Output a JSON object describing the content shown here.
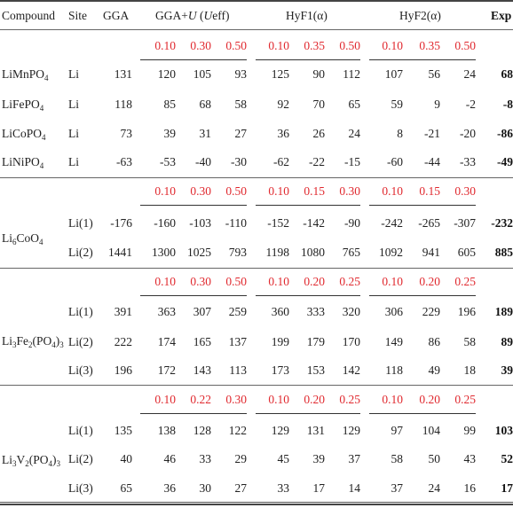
{
  "header": {
    "compound": "Compound",
    "site": "Site",
    "gga": "GGA",
    "ggau_prefix": "GGA+",
    "ggau_u": "U",
    "ggau_open": " (",
    "ggau_ueff_u": "U",
    "ggau_ueff_rest": "eff)",
    "hyf1": "HyF1(α)",
    "hyf2": "HyF2(α)",
    "exp": "Exp"
  },
  "groups": [
    {
      "params": {
        "ggau": [
          "0.10",
          "0.30",
          "0.50"
        ],
        "hyf1": [
          "0.10",
          "0.35",
          "0.50"
        ],
        "hyf2": [
          "0.10",
          "0.35",
          "0.50"
        ]
      },
      "rows": [
        {
          "compound": {
            "base": "LiMnPO",
            "sub": "4",
            "tail": ""
          },
          "site": "Li",
          "gga": "131",
          "ggau": [
            "120",
            "105",
            "93"
          ],
          "hyf1": [
            "125",
            "90",
            "112"
          ],
          "hyf2": [
            "107",
            "56",
            "24"
          ],
          "exp": "68"
        },
        {
          "compound": {
            "base": "LiFePO",
            "sub": "4",
            "tail": ""
          },
          "site": "Li",
          "gga": "118",
          "ggau": [
            "85",
            "68",
            "58"
          ],
          "hyf1": [
            "92",
            "70",
            "65"
          ],
          "hyf2": [
            "59",
            "9",
            "-2"
          ],
          "exp": "-8"
        },
        {
          "compound": {
            "base": "LiCoPO",
            "sub": "4",
            "tail": ""
          },
          "site": "Li",
          "gga": "73",
          "ggau": [
            "39",
            "31",
            "27"
          ],
          "hyf1": [
            "36",
            "26",
            "24"
          ],
          "hyf2": [
            "8",
            "-21",
            "-20"
          ],
          "exp": "-86"
        },
        {
          "compound": {
            "base": "LiNiPO",
            "sub": "4",
            "tail": ""
          },
          "site": "Li",
          "gga": "-63",
          "ggau": [
            "-53",
            "-40",
            "-30"
          ],
          "hyf1": [
            "-62",
            "-22",
            "-15"
          ],
          "hyf2": [
            "-60",
            "-44",
            "-33"
          ],
          "exp": "-49"
        }
      ]
    },
    {
      "compound_label": {
        "parts": [
          [
            "Li",
            ""
          ],
          [
            "6",
            "sub"
          ],
          [
            "CoO",
            ""
          ],
          [
            "4",
            "sub"
          ]
        ]
      },
      "params": {
        "ggau": [
          "0.10",
          "0.30",
          "0.50"
        ],
        "hyf1": [
          "0.10",
          "0.15",
          "0.30"
        ],
        "hyf2": [
          "0.10",
          "0.15",
          "0.30"
        ]
      },
      "rows": [
        {
          "site": "Li(1)",
          "gga": "-176",
          "ggau": [
            "-160",
            "-103",
            "-110"
          ],
          "hyf1": [
            "-152",
            "-142",
            "-90"
          ],
          "hyf2": [
            "-242",
            "-265",
            "-307"
          ],
          "exp": "-232"
        },
        {
          "site": "Li(2)",
          "gga": "1441",
          "ggau": [
            "1300",
            "1025",
            "793"
          ],
          "hyf1": [
            "1198",
            "1080",
            "765"
          ],
          "hyf2": [
            "1092",
            "941",
            "605"
          ],
          "exp": "885"
        }
      ]
    },
    {
      "compound_label": {
        "parts": [
          [
            "Li",
            ""
          ],
          [
            "3",
            "sub"
          ],
          [
            "Fe",
            ""
          ],
          [
            "2",
            "sub"
          ],
          [
            "(PO",
            ""
          ],
          [
            "4",
            "sub"
          ],
          [
            ")",
            ""
          ],
          [
            "3",
            "sub"
          ]
        ]
      },
      "params": {
        "ggau": [
          "0.10",
          "0.30",
          "0.50"
        ],
        "hyf1": [
          "0.10",
          "0.20",
          "0.25"
        ],
        "hyf2": [
          "0.10",
          "0.20",
          "0.25"
        ]
      },
      "rows": [
        {
          "site": "Li(1)",
          "gga": "391",
          "ggau": [
            "363",
            "307",
            "259"
          ],
          "hyf1": [
            "360",
            "333",
            "320"
          ],
          "hyf2": [
            "306",
            "229",
            "196"
          ],
          "exp": "189"
        },
        {
          "site": "Li(2)",
          "gga": "222",
          "ggau": [
            "174",
            "165",
            "137"
          ],
          "hyf1": [
            "199",
            "179",
            "170"
          ],
          "hyf2": [
            "149",
            "86",
            "58"
          ],
          "exp": "89"
        },
        {
          "site": "Li(3)",
          "gga": "196",
          "ggau": [
            "172",
            "143",
            "113"
          ],
          "hyf1": [
            "173",
            "153",
            "142"
          ],
          "hyf2": [
            "118",
            "49",
            "18"
          ],
          "exp": "39"
        }
      ]
    },
    {
      "compound_label": {
        "parts": [
          [
            "Li",
            ""
          ],
          [
            "3",
            "sub"
          ],
          [
            "V",
            ""
          ],
          [
            "2",
            "sub"
          ],
          [
            "(PO",
            ""
          ],
          [
            "4",
            "sub"
          ],
          [
            ")",
            ""
          ],
          [
            "3",
            "sub"
          ]
        ]
      },
      "params": {
        "ggau": [
          "0.10",
          "0.22",
          "0.30"
        ],
        "hyf1": [
          "0.10",
          "0.20",
          "0.25"
        ],
        "hyf2": [
          "0.10",
          "0.20",
          "0.25"
        ]
      },
      "rows": [
        {
          "site": "Li(1)",
          "gga": "135",
          "ggau": [
            "138",
            "128",
            "122"
          ],
          "hyf1": [
            "129",
            "131",
            "129"
          ],
          "hyf2": [
            "97",
            "104",
            "99"
          ],
          "exp": "103"
        },
        {
          "site": "Li(2)",
          "gga": "40",
          "ggau": [
            "46",
            "33",
            "29"
          ],
          "hyf1": [
            "45",
            "39",
            "37"
          ],
          "hyf2": [
            "58",
            "50",
            "43"
          ],
          "exp": "52"
        },
        {
          "site": "Li(3)",
          "gga": "65",
          "ggau": [
            "36",
            "30",
            "27"
          ],
          "hyf1": [
            "33",
            "17",
            "14"
          ],
          "hyf2": [
            "37",
            "24",
            "16"
          ],
          "exp": "17"
        }
      ]
    }
  ],
  "colors": {
    "param_red": "#e0282e",
    "text": "#222222"
  }
}
